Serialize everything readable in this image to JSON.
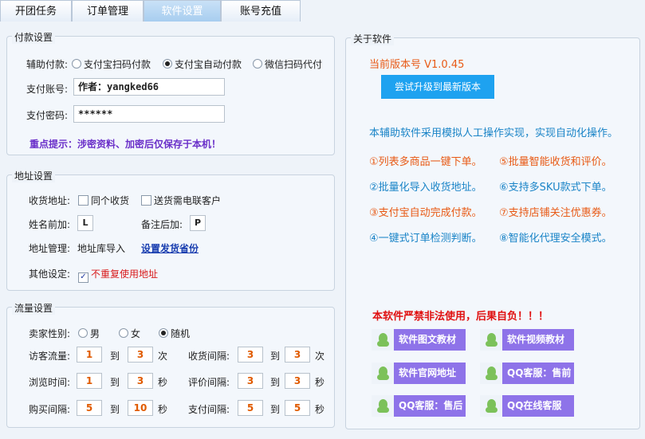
{
  "tabs": [
    {
      "label": "开团任务"
    },
    {
      "label": "订单管理"
    },
    {
      "label": "软件设置"
    },
    {
      "label": "账号充值"
    }
  ],
  "payment": {
    "legend": "付款设置",
    "method_label": "辅助付款:",
    "options": [
      "支付宝扫码付款",
      "支付宝自动付款",
      "微信扫码代付"
    ],
    "selected": "支付宝自动付款",
    "account_label": "支付账号:",
    "account_value": "作者：yangked66",
    "password_label": "支付密码:",
    "password_value": "******",
    "notice": "重点提示：涉密资料、加密后仅保存于本机！"
  },
  "address": {
    "legend": "地址设置",
    "receive_label": "收货地址:",
    "same_receive": "同个收货",
    "deliver_ecom": "送货需电联客户",
    "name_prefix_label": "姓名前加:",
    "name_prefix_value": "L",
    "remark_suffix_label": "备注后加:",
    "remark_suffix_value": "P",
    "manage_label": "地址管理:",
    "import_label": "地址库导入",
    "set_province_link": "设置发货省份",
    "other_label": "其他设定:",
    "no_repeat": "不重复使用地址"
  },
  "traffic": {
    "legend": "流量设置",
    "gender_label": "卖家性别:",
    "gender_options": [
      "男",
      "女",
      "随机"
    ],
    "gender_selected": "随机",
    "to": "到",
    "rows": [
      {
        "label": "访客流量:",
        "from": "1",
        "to": "3",
        "unit": "次",
        "label2": "收货间隔:",
        "from2": "3",
        "to2": "3",
        "unit2": "次"
      },
      {
        "label": "浏览时间:",
        "from": "1",
        "to": "3",
        "unit": "秒",
        "label2": "评价间隔:",
        "from2": "3",
        "to2": "3",
        "unit2": "秒"
      },
      {
        "label": "购买间隔:",
        "from": "5",
        "to": "10",
        "unit": "秒",
        "label2": "支付间隔:",
        "from2": "5",
        "to2": "5",
        "unit2": "秒"
      }
    ]
  },
  "about": {
    "legend": "关于软件",
    "version": "当前版本号 V1.0.45",
    "upgrade_button": "尝试升级到最新版本",
    "description": "本辅助软件采用模拟人工操作实现，实现自动化操作。",
    "features": [
      "①列表多商品一键下单。",
      "⑤批量智能收货和评价。",
      "②批量化导入收货地址。",
      "⑥支持多SKU款式下单。",
      "③支付宝自动完成付款。",
      "⑦支持店铺关注优惠券。",
      "④一键式订单检测判断。",
      "⑧智能化代理安全模式。"
    ],
    "warning": "本软件严禁非法使用，后果自负！！！",
    "links": [
      "软件图文教材",
      "软件视频教材",
      "软件官网地址",
      "QQ客服：售前",
      "QQ客服：售后",
      "QQ在线客服"
    ],
    "colors": {
      "accent": "#1ea2f0",
      "link_button": "#8e73e9",
      "warning": "#e01010",
      "feature_blue": "#1a84c7",
      "feature_orange": "#e85a15"
    }
  }
}
